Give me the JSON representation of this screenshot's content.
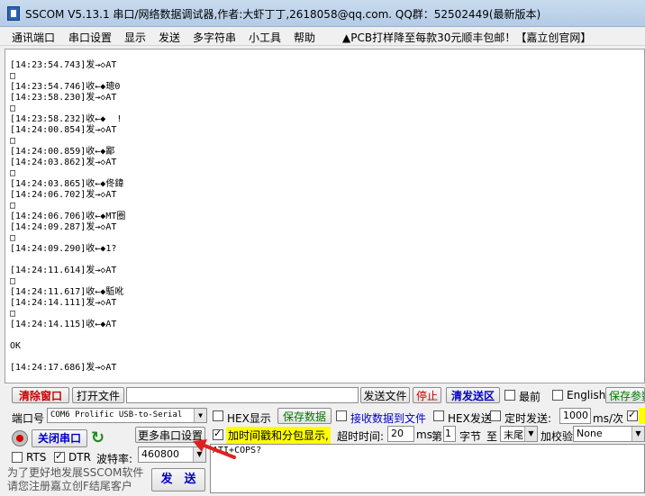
{
  "window": {
    "title": "SSCOM V5.13.1 串口/网络数据调试器,作者:大虾丁丁,2618058@qq.com. QQ群：52502449(最新版本)"
  },
  "menu": {
    "items": [
      "通讯端口",
      "串口设置",
      "显示",
      "发送",
      "多字符串",
      "小工具",
      "帮助"
    ],
    "ad": "▲PCB打样降至每款30元顺丰包邮！【嘉立创官网】"
  },
  "terminal": {
    "lines": [
      "[14:23:54.743]发→◇AT",
      "□",
      "[14:23:54.746]收←◆璁0",
      "[14:23:58.230]发→◇AT",
      "□",
      "[14:23:58.232]收←◆  !",
      "[14:24:00.854]发→◇AT",
      "□",
      "[14:24:00.859]收←◆鄙",
      "[14:24:03.862]发→◇AT",
      "□",
      "[14:24:03.865]收←◆佟鍏",
      "[14:24:06.702]发→◇AT",
      "□",
      "[14:24:06.706]收←◆MT圈",
      "[14:24:09.287]发→◇AT",
      "□",
      "[14:24:09.290]收←◆1?",
      "",
      "[14:24:11.614]发→◇AT",
      "□",
      "[14:24:11.617]收←◆駈吪",
      "[14:24:14.111]发→◇AT",
      "□",
      "[14:24:14.115]收←◆AT",
      "",
      "OK",
      "",
      "[14:24:17.686]发→◇AT"
    ]
  },
  "toolbar1": {
    "clear_window": "清除窗口",
    "open_file": "打开文件",
    "send_file": "发送文件",
    "stop": "停止",
    "clear_send": "清发送区",
    "topmost": "最前",
    "english": "English",
    "save_params": "保存参数"
  },
  "row2": {
    "port_label": "端口号",
    "port_value": "COM6 Prolific USB-to-Serial",
    "hex_display": "HEX显示",
    "save_data": "保存数据",
    "recv_to_file": "接收数据到文件",
    "hex_send": "HEX发送",
    "timed_send": "定时发送:",
    "interval_value": "1000",
    "interval_unit": "ms/次"
  },
  "row3": {
    "close_port": "关闭串口",
    "more_settings": "更多串口设置",
    "timestamp": "加时间戳和分包显示,",
    "timeout_label": "超时时间:",
    "timeout_value": "20",
    "timeout_unit": "ms",
    "byte_label_1": "第",
    "byte_value": "1",
    "byte_label_2": "字节",
    "to_label": "至",
    "end_value": "末尾",
    "checksum_label": "加校验",
    "checksum_value": "None"
  },
  "row4": {
    "rts": "RTS",
    "dtr": "DTR",
    "baud_label": "波特率:",
    "baud_value": "460800",
    "send_text": "ATI+COPS?"
  },
  "footer": {
    "promo_line1": "为了更好地发展SSCOM软件",
    "promo_line2": "请您注册嘉立创F结尾客户",
    "send_button": "发　送"
  },
  "colors": {
    "clear_window": "#c80000",
    "stop": "#c80000",
    "clear_send": "#0000c8",
    "save_data": "#007800",
    "save_params": "#007800",
    "close_port": "#0000c8",
    "timestamp_highlight": "#ffff00",
    "annotation_arrow": "#e02020"
  }
}
